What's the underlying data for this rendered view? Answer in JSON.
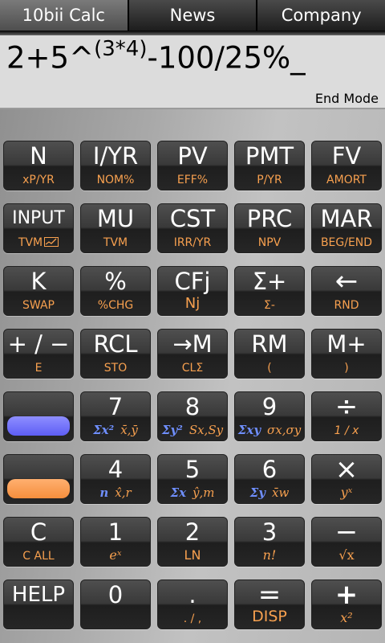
{
  "tabs": [
    "10bii Calc",
    "News",
    "Company"
  ],
  "display": {
    "expr_a": "2+5^",
    "expr_exp": "(3*4)",
    "expr_b": "-100/25%_",
    "mode": "End Mode"
  },
  "keys": {
    "n": {
      "main": "N",
      "sub": "xP/YR"
    },
    "iyr": {
      "main": "I/YR",
      "sub": "NOM%"
    },
    "pv": {
      "main": "PV",
      "sub": "EFF%"
    },
    "pmt": {
      "main": "PMT",
      "sub": "P/YR"
    },
    "fv": {
      "main": "FV",
      "sub": "AMORT"
    },
    "input": {
      "main": "INPUT",
      "sub": "TVM"
    },
    "mu": {
      "main": "MU",
      "sub": "TVM"
    },
    "cst": {
      "main": "CST",
      "sub": "IRR/YR"
    },
    "prc": {
      "main": "PRC",
      "sub": "NPV"
    },
    "mar": {
      "main": "MAR",
      "sub": "BEG/END"
    },
    "k": {
      "main": "K",
      "sub": "SWAP"
    },
    "pct": {
      "main": "%",
      "sub": "%CHG"
    },
    "cfj": {
      "main": "CFj",
      "sub": "Nj"
    },
    "sigplus": {
      "main": "Σ+",
      "sub": "Σ-"
    },
    "back": {
      "main": "←",
      "sub": "RND"
    },
    "pm": {
      "main": "+ / −",
      "sub": "E"
    },
    "rcl": {
      "main": "RCL",
      "sub": "STO"
    },
    "tom": {
      "main": "→M",
      "sub": "CLΣ"
    },
    "rm": {
      "main": "RM",
      "sub": "("
    },
    "mplus": {
      "main": "M+",
      "sub": ")"
    },
    "k7": {
      "main": "7",
      "sub_a": "Σx²",
      "sub_b": "x̄,ȳ"
    },
    "k8": {
      "main": "8",
      "sub_a": "Σy²",
      "sub_b": "Sx,Sy"
    },
    "k9": {
      "main": "9",
      "sub_a": "Σxy",
      "sub_b": "σx,σy"
    },
    "div": {
      "main": "÷",
      "sub": "1 / x"
    },
    "k4": {
      "main": "4",
      "sub_a": "n",
      "sub_b": "x̂,r"
    },
    "k5": {
      "main": "5",
      "sub_a": "Σx",
      "sub_b": "ŷ,m"
    },
    "k6": {
      "main": "6",
      "sub_a": "Σy",
      "sub_b": "x̄w"
    },
    "mul": {
      "main": "×",
      "sub": "yˣ"
    },
    "c": {
      "main": "C",
      "sub": "C ALL"
    },
    "k1": {
      "main": "1",
      "sub": "eˣ"
    },
    "k2": {
      "main": "2",
      "sub": "LN"
    },
    "k3": {
      "main": "3",
      "sub": "n!"
    },
    "minus": {
      "main": "−",
      "sub": "√x"
    },
    "help": {
      "main": "HELP",
      "sub": ""
    },
    "k0": {
      "main": "0",
      "sub": ""
    },
    "dot": {
      "main": ".",
      "sub": ". / ,"
    },
    "eq": {
      "main": "=",
      "sub": "DISP"
    },
    "plus": {
      "main": "+",
      "sub": "x²"
    }
  },
  "colors": {
    "shift_blue": "#6f6ff5",
    "shift_orange": "#f7a04f"
  }
}
